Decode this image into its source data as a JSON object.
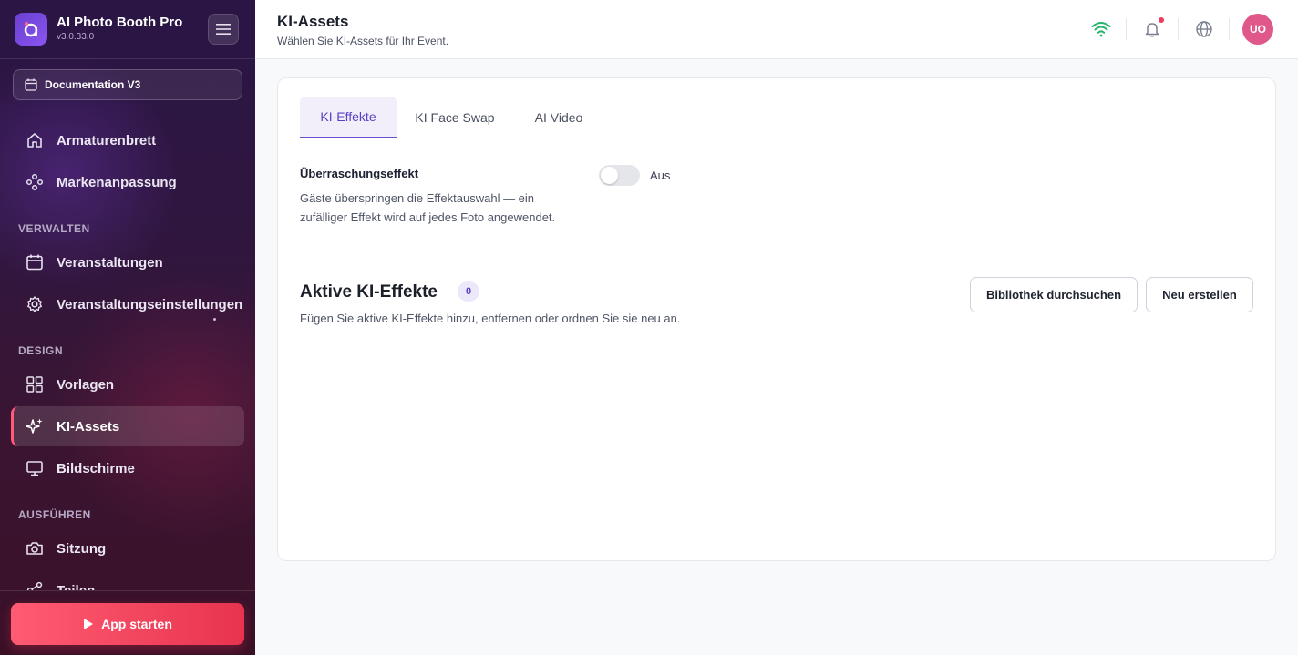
{
  "app": {
    "name": "AI Photo Booth Pro",
    "version": "v3.0.33.0"
  },
  "event_selector": {
    "label": "Documentation V3"
  },
  "sidebar": {
    "sections": {
      "manage": "VERWALTEN",
      "design": "DESIGN",
      "run": "AUSFÜHREN"
    },
    "items": [
      {
        "label": "Armaturenbrett",
        "icon": "home-icon"
      },
      {
        "label": "Markenanpassung",
        "icon": "brand-icon"
      },
      {
        "label": "Veranstaltungen",
        "icon": "calendar-icon"
      },
      {
        "label": "Veranstaltungseinstellungen",
        "icon": "gear-icon"
      },
      {
        "label": "Vorlagen",
        "icon": "grid-icon"
      },
      {
        "label": "KI-Assets",
        "icon": "sparkles-icon",
        "active": true
      },
      {
        "label": "Bildschirme",
        "icon": "monitor-icon"
      },
      {
        "label": "Sitzung",
        "icon": "camera-icon"
      },
      {
        "label": "Teilen",
        "icon": "share-icon"
      }
    ],
    "start_button": "App starten"
  },
  "header": {
    "title": "KI-Assets",
    "subtitle": "Wählen Sie KI-Assets für Ihr Event.",
    "avatar_initials": "UO"
  },
  "tabs": [
    {
      "label": "KI-Effekte",
      "active": true
    },
    {
      "label": "KI Face Swap",
      "active": false
    },
    {
      "label": "AI Video",
      "active": false
    }
  ],
  "surprise_effect": {
    "title": "Überraschungseffekt",
    "description": "Gäste überspringen die Effektauswahl — ein zufälliger Effekt wird auf jedes Foto angewendet.",
    "toggle_state": "Aus"
  },
  "active_effects": {
    "title": "Aktive KI-Effekte",
    "count": "0",
    "description": "Fügen Sie aktive KI-Effekte hinzu, entfernen oder ordnen Sie sie neu an.",
    "browse_button": "Bibliothek durchsuchen",
    "create_button": "Neu erstellen"
  },
  "colors": {
    "accent": "#5b3fc4",
    "start_button": "#e8344e",
    "wifi": "#22b46a",
    "avatar": "#e0578a"
  }
}
